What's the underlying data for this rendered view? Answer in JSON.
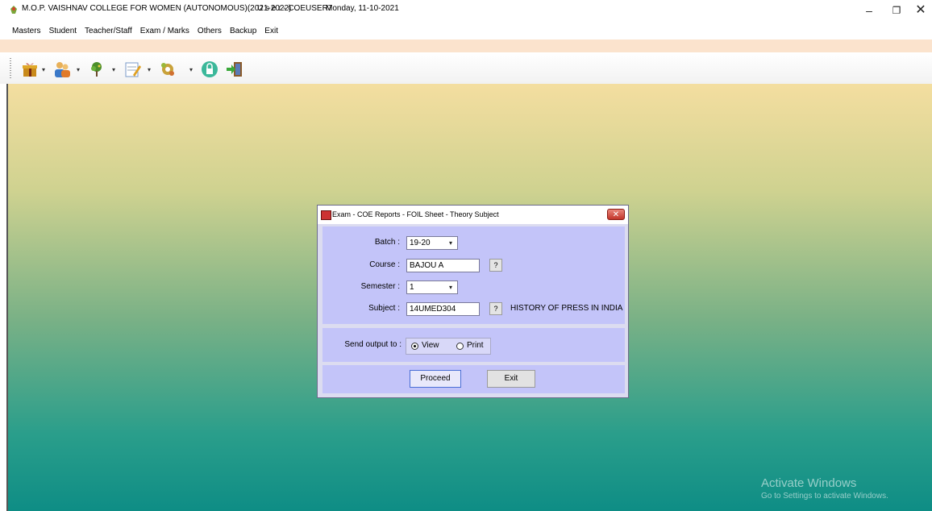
{
  "window": {
    "title": "M.O.P. VAISHNAV COLLEGE FOR WOMEN (AUTONOMOUS)(2021-2022)",
    "user": "U s e r - COEUSER7",
    "date": "Monday, 11-10-2021",
    "minimize": "–",
    "maximize": "❐",
    "close": "✕"
  },
  "menu": [
    "Masters",
    "Student",
    "Teacher/Staff",
    "Exam / Marks",
    "Others",
    "Backup",
    "Exit"
  ],
  "toolbar": {
    "icons": [
      "gift-icon",
      "users-icon",
      "tree-icon",
      "notepad-icon",
      "gear-icon",
      "lock-icon",
      "exit-door-icon"
    ]
  },
  "dialog": {
    "title": "Exam - COE Reports - FOIL Sheet - Theory Subject",
    "close": "✕",
    "batch_label": "Batch :",
    "batch_value": "19-20",
    "course_label": "Course :",
    "course_value": "BAJOU A",
    "semester_label": "Semester :",
    "semester_value": "1",
    "subject_label": "Subject :",
    "subject_value": "14UMED304",
    "subject_name": "HISTORY OF PRESS IN INDIA",
    "lookup": "?",
    "output_label": "Send output to :",
    "opt_view": "View",
    "opt_print": "Print",
    "proceed": "Proceed",
    "exit": "Exit"
  },
  "watermark": {
    "line1": "Activate Windows",
    "line2": "Go to Settings to activate Windows."
  }
}
